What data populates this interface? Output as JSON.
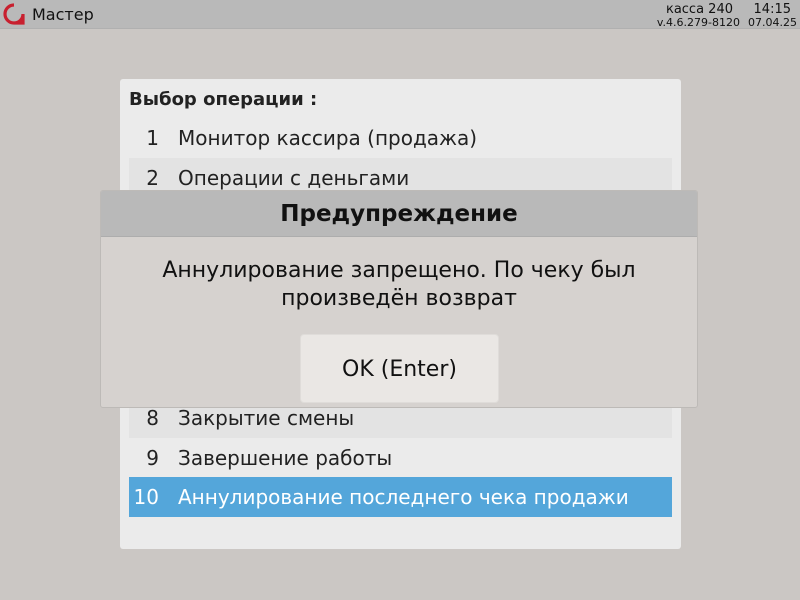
{
  "topbar": {
    "app_title": "Мастер",
    "kassa": "касса 240",
    "time": "14:15",
    "version": "v.4.6.279-8120",
    "date": "07.04.25",
    "logo_icon": "app-logo-icon",
    "logo_color": "#c8202f"
  },
  "menu": {
    "title": "Выбор операции :",
    "items": [
      {
        "num": "1",
        "label": "Монитор кассира (продажа)"
      },
      {
        "num": "2",
        "label": "Операции с деньгами"
      },
      {
        "num": "8",
        "label": "Закрытие смены"
      },
      {
        "num": "9",
        "label": "Завершение работы"
      },
      {
        "num": "10",
        "label": "Аннулирование последнего чека продажи"
      }
    ],
    "selected_index": 4,
    "selected_color": "#54a6da"
  },
  "dialog": {
    "title": "Предупреждение",
    "message_line1": "Аннулирование запрещено. По чеку был",
    "message_line2": "произведён возврат",
    "ok_label": "OK (Enter)"
  }
}
